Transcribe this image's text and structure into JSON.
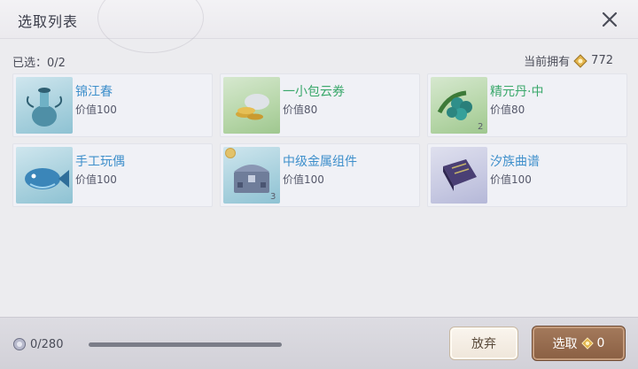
{
  "dialog": {
    "title": "选取列表",
    "selected_label": "已选：0/2",
    "owned_label": "当前拥有",
    "owned_value": "772"
  },
  "items": [
    {
      "name": "锦江春",
      "value": "价值100",
      "qty": "",
      "name_color": "blue",
      "icon": "vase-icon"
    },
    {
      "name": "一小包云券",
      "value": "价值80",
      "qty": "",
      "name_color": "green",
      "icon": "coin-pouch-icon"
    },
    {
      "name": "精元丹·中",
      "value": "价值80",
      "qty": "2",
      "name_color": "green",
      "icon": "berries-icon"
    },
    {
      "name": "手工玩偶",
      "value": "价值100",
      "qty": "",
      "name_color": "blue",
      "icon": "fish-toy-icon"
    },
    {
      "name": "中级金属组件",
      "value": "价值100",
      "qty": "3",
      "name_color": "blue",
      "icon": "metal-chest-icon"
    },
    {
      "name": "汐族曲谱",
      "value": "价值100",
      "qty": "",
      "name_color": "blue",
      "icon": "book-icon"
    }
  ],
  "footer": {
    "count_label": "0/280",
    "progress": 0.0,
    "cancel_label": "放弃",
    "confirm_label": "选取",
    "confirm_value": "0"
  },
  "colors": {
    "name_blue": "#3e8fcb",
    "name_green": "#3aa86b",
    "confirm_button": "#8a5f43"
  }
}
